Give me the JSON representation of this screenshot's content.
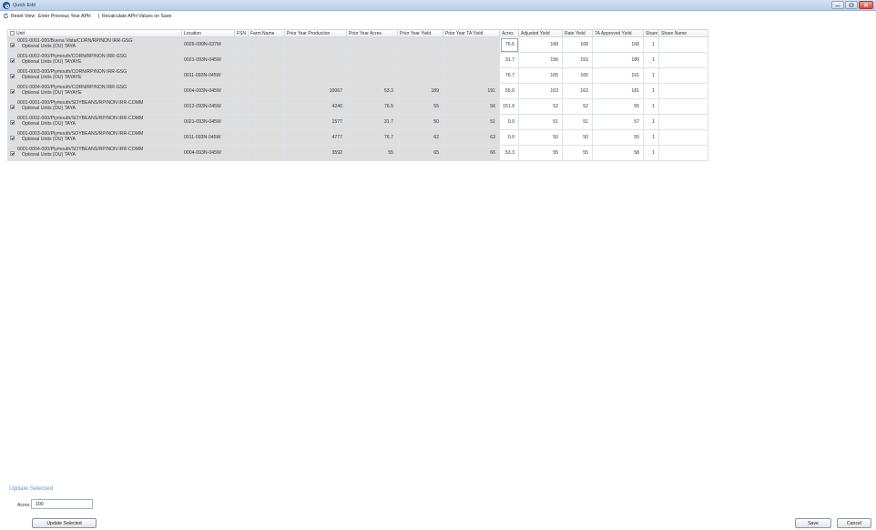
{
  "window": {
    "title": "Quick Edit"
  },
  "toolbar": {
    "reset_view": "Reset View",
    "enter_previous": "Enter Previous Year APH",
    "recalculate": "Recalculate APH Values on Save"
  },
  "grid": {
    "columns": [
      "Unit",
      "Location",
      "FSN",
      "Farm Name",
      "Prior Year Production",
      "Prior Year Acres",
      "Prior Year Yield",
      "Prior Year TA Yield",
      "Acres",
      "Adjusted Yield",
      "Rate Yield",
      "TA Approved Yield",
      "Share",
      "Share Name"
    ],
    "rows": [
      {
        "unit1": "0001-0001-000/Buena Vista/CORN/RP/NON IRR-GSG",
        "unit2": "Optional Units (OU)  TAYA",
        "location": "0026-090N-037W",
        "fsn": "",
        "farm": "",
        "pyp": "",
        "pya": "",
        "pyy": "",
        "pyta": "",
        "acres": "76.5",
        "adj": "168",
        "rate": "168",
        "ta": "168",
        "share": "1",
        "share_name": ""
      },
      {
        "unit1": "0001-0002-000/Plymouth/CORN/RP/NON IRR-GSG",
        "unit2": "Optional Units (OU)  TAYAYE",
        "location": "0021-093N-045W",
        "fsn": "",
        "farm": "",
        "pyp": "",
        "pya": "",
        "pyy": "",
        "pyta": "",
        "acres": "31.7",
        "adj": "156",
        "rate": "153",
        "ta": "180",
        "share": "1",
        "share_name": ""
      },
      {
        "unit1": "0001-0003-000/Plymouth/CORN/RP/NON IRR-GSG",
        "unit2": "Optional Units (OU)  TAYAYE",
        "location": "0011-093N-045W",
        "fsn": "",
        "farm": "",
        "pyp": "",
        "pya": "",
        "pyy": "",
        "pyta": "",
        "acres": "76.7",
        "adj": "165",
        "rate": "165",
        "ta": "191",
        "share": "1",
        "share_name": ""
      },
      {
        "unit1": "0001-0004-000/Plymouth/CORN/RP/NON IRR-GSG",
        "unit2": "Optional Units (OU)  TAYAYE",
        "location": "0004-093N-045W",
        "fsn": "",
        "farm": "",
        "pyp": "10067",
        "pya": "53.3",
        "pyy": "189",
        "pyta": "191",
        "acres": "55.0",
        "adj": "163",
        "rate": "163",
        "ta": "181",
        "share": "1",
        "share_name": ""
      },
      {
        "unit1": "0001-0001-000/Plymouth/SOYBEANS/RP/NON IRR-COMM",
        "unit2": "Optional Units (OU)  TAYA",
        "location": "0012-093N-045W",
        "fsn": "",
        "farm": "",
        "pyp": "4240",
        "pya": "76.5",
        "pyy": "55",
        "pyta": "56",
        "acres": "151.9",
        "adj": "52",
        "rate": "52",
        "ta": "55",
        "share": "1",
        "share_name": ""
      },
      {
        "unit1": "0001-0002-000/Plymouth/SOYBEANS/RP/NON IRR-COMM",
        "unit2": "Optional Units (OU)  TAYA",
        "location": "0021-093N-045W",
        "fsn": "",
        "farm": "",
        "pyp": "1577",
        "pya": "31.7",
        "pyy": "50",
        "pyta": "51",
        "acres": "0.0",
        "adj": "51",
        "rate": "51",
        "ta": "57",
        "share": "1",
        "share_name": ""
      },
      {
        "unit1": "0001-0003-000/Plymouth/SOYBEANS/RP/NON IRR-COMM",
        "unit2": "Optional Units (OU)  TAYA",
        "location": "0011-093N-045W",
        "fsn": "",
        "farm": "",
        "pyp": "4777",
        "pya": "76.7",
        "pyy": "62",
        "pyta": "63",
        "acres": "0.0",
        "adj": "50",
        "rate": "50",
        "ta": "55",
        "share": "1",
        "share_name": ""
      },
      {
        "unit1": "0001-0004-000/Plymouth/SOYBEANS/RP/NON IRR-COMM",
        "unit2": "Optional Units (OU)  TAYA",
        "location": "0004-093N-045W",
        "fsn": "",
        "farm": "",
        "pyp": "3592",
        "pya": "55",
        "pyy": "65",
        "pyta": "66",
        "acres": "53.3",
        "adj": "55",
        "rate": "55",
        "ta": "58",
        "share": "1",
        "share_name": ""
      }
    ]
  },
  "update_panel": {
    "title": "Update Selected",
    "acres_label": "Acres:",
    "acres_value": "100",
    "button_label": "Update Selected"
  },
  "footer": {
    "save_label": "Save",
    "cancel_label": "Cancel"
  },
  "icons": {
    "app": "quick-edit-icon",
    "refresh": "refresh-icon"
  },
  "colors": {
    "titlebar": "#c7d9ee",
    "accent": "#5c9ad6",
    "readonly_cell": "#dedede",
    "row_alt": "#e2ebf3"
  }
}
